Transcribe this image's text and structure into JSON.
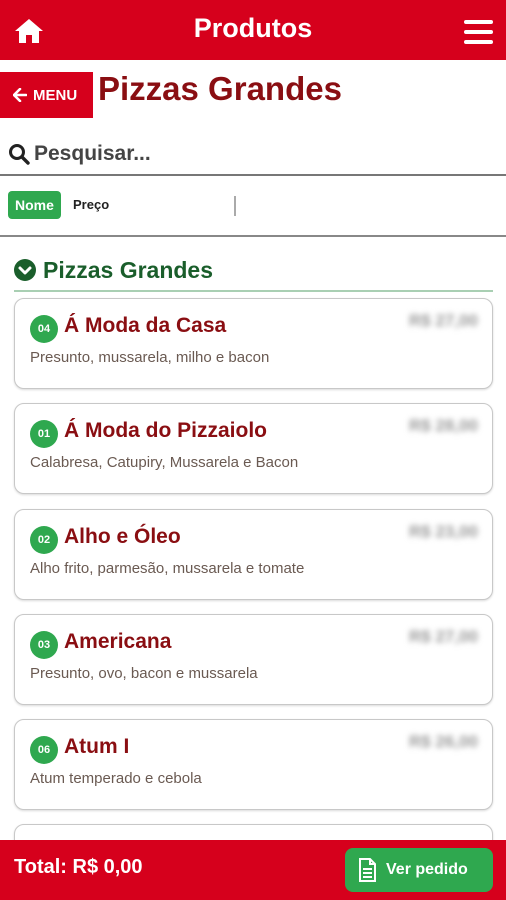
{
  "header": {
    "title": "Produtos"
  },
  "nav": {
    "back_label": "MENU",
    "page_title": "Pizzas Grandes"
  },
  "search": {
    "placeholder": "Pesquisar..."
  },
  "sort": {
    "options": [
      "Nome",
      "Preço"
    ],
    "active": "Nome"
  },
  "category": {
    "title": "Pizzas Grandes"
  },
  "products": [
    {
      "code": "04",
      "name": "Á Moda da Casa",
      "description": "Presunto, mussarela, milho e bacon",
      "price": "R$ 27,00"
    },
    {
      "code": "01",
      "name": "Á Moda do Pizzaiolo",
      "description": "Calabresa, Catupiry, Mussarela e Bacon",
      "price": "R$ 28,00"
    },
    {
      "code": "02",
      "name": "Alho e Óleo",
      "description": "Alho frito, parmesão, mussarela e tomate",
      "price": "R$ 23,00"
    },
    {
      "code": "03",
      "name": "Americana",
      "description": "Presunto, ovo, bacon e mussarela",
      "price": "R$ 27,00"
    },
    {
      "code": "06",
      "name": "Atum I",
      "description": "Atum temperado e cebola",
      "price": "R$ 26,00"
    }
  ],
  "footer": {
    "total_label": "Total: R$ 0,00",
    "order_button": "Ver pedido"
  },
  "colors": {
    "brand_red": "#d6001c",
    "dark_red_text": "#8a0e12",
    "green": "#2fa84f",
    "dark_green": "#1a5e2b"
  }
}
